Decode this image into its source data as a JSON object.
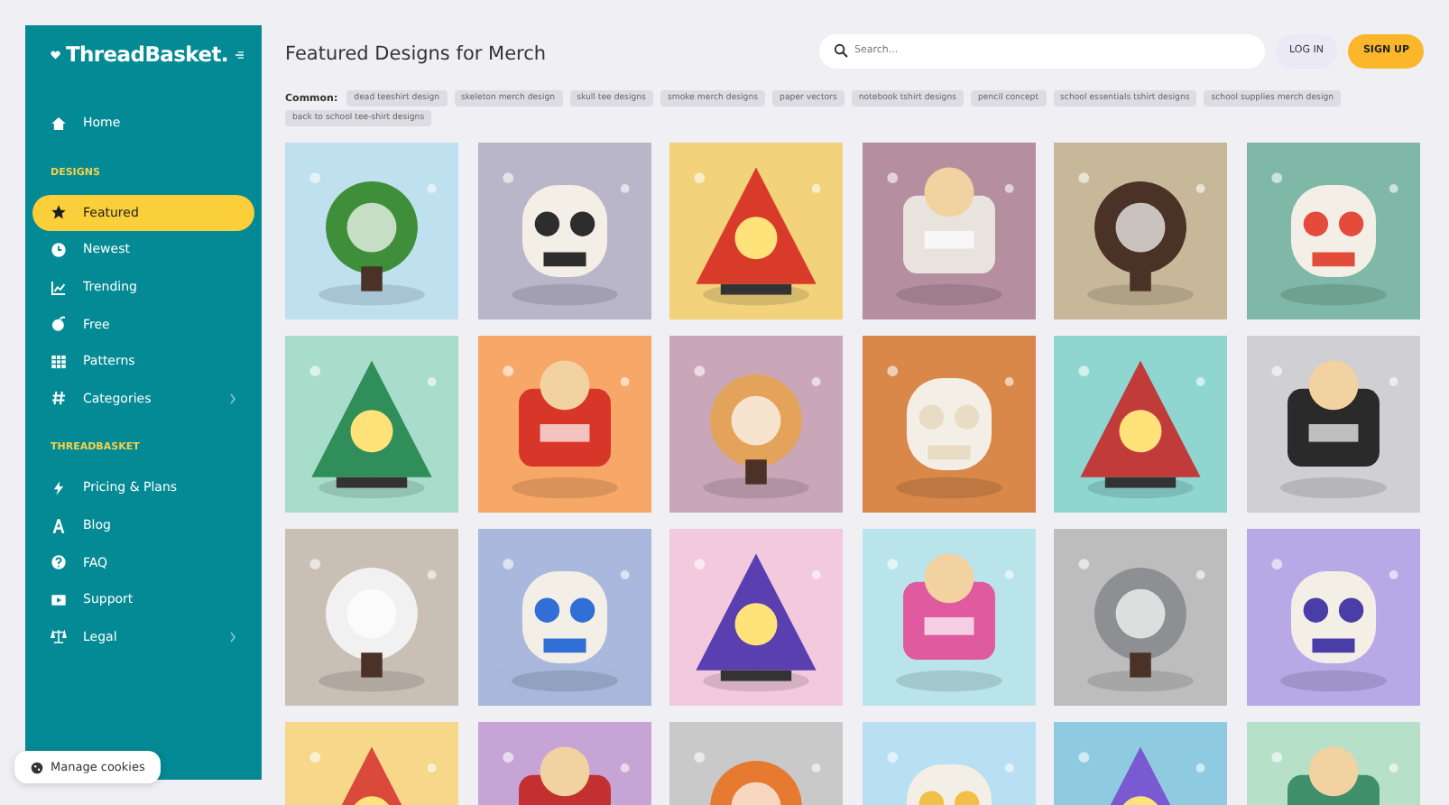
{
  "sidebar": {
    "logo": "ThreadBasket.",
    "sections": [
      {
        "items": [
          {
            "label": "Home",
            "selected": false,
            "submenu": false
          }
        ]
      },
      {
        "heading": "DESIGNS",
        "items": [
          {
            "label": "Featured",
            "selected": true,
            "submenu": false
          },
          {
            "label": "Newest",
            "selected": false,
            "submenu": false
          },
          {
            "label": "Trending",
            "selected": false,
            "submenu": false
          },
          {
            "label": "Free",
            "selected": false,
            "submenu": false
          },
          {
            "label": "Patterns",
            "selected": false,
            "submenu": false
          },
          {
            "label": "Categories",
            "selected": false,
            "submenu": true
          }
        ]
      },
      {
        "heading": "THREADBASKET",
        "items": [
          {
            "label": "Pricing & Plans",
            "selected": false,
            "submenu": false
          },
          {
            "label": "Blog",
            "selected": false,
            "submenu": false
          },
          {
            "label": "FAQ",
            "selected": false,
            "submenu": false
          },
          {
            "label": "Support",
            "selected": false,
            "submenu": false
          },
          {
            "label": "Legal",
            "selected": false,
            "submenu": true
          }
        ]
      }
    ]
  },
  "header": {
    "title": "Featured Designs for Merch",
    "search": {
      "placeholder": "Search..."
    },
    "buttons": [
      "LOG IN",
      "SIGN UP"
    ]
  },
  "common": {
    "label": "Common:",
    "tags": [
      "dead teeshirt design",
      "skeleton merch design",
      "skull tee designs",
      "smoke merch designs",
      "paper vectors",
      "notebook tshirt designs",
      "pencil concept",
      "school essentials tshirt designs",
      "school supplies merch design",
      "back to school tee-shirt designs"
    ]
  },
  "cookies": {
    "label": "Manage cookies"
  }
}
